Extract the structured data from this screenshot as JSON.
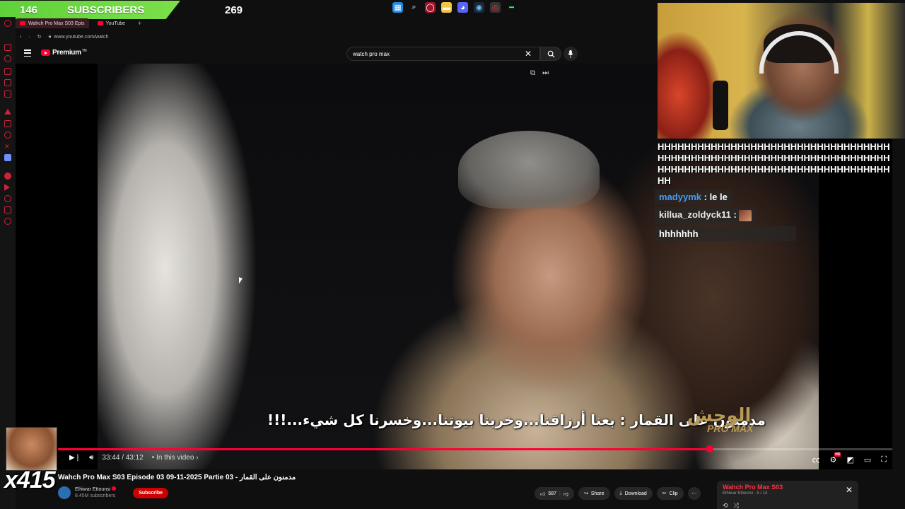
{
  "stream_overlay": {
    "subscriber_count": "146",
    "subscribers_label": "SUBSCRIBERS",
    "subscriber_goal": "269",
    "meme_counter": "x415"
  },
  "browser": {
    "tabs": [
      {
        "label": "Wahch Pro Max S03 Epis",
        "active": true
      },
      {
        "label": "YouTube",
        "active": false
      }
    ],
    "new_tab": "+",
    "url": "www.youtube.com/watch"
  },
  "youtube": {
    "logo_text": "Premium",
    "logo_tm": "TM",
    "search_query": "watch pro max"
  },
  "video": {
    "subtitle": "مدمنون على القمار : بعنا أرزاقنا...وخربنا بيوتنا...وخسرنا كل شيء...!!!",
    "watermark_ar": "الوحش",
    "watermark_en": "PRO MAX",
    "current_time": "33:44",
    "duration": "43:12",
    "time_display": "33:44 / 43:12",
    "chapter_label": "• In this video ›",
    "progress_fraction": 0.781
  },
  "video_info": {
    "title": "Wahch Pro Max S03 Episode 03 09-11-2025 Partie 03 - مدمنون على القمار",
    "channel_name": "Elhiwar Ettounsi",
    "channel_subs": "8.45M subscribers",
    "subscribe_label": "Subscribe",
    "like_count": "587",
    "share_label": "Share",
    "download_label": "Download",
    "clip_label": "Clip"
  },
  "playlist": {
    "title": "Wahch Pro Max S03",
    "subtitle": "Elhiwar Ettounsi - 5 / 14"
  },
  "chat": {
    "messages": [
      {
        "user": "",
        "text": "HHHHHHHHHHHHHHHHHHHHHHHHHHHHHHHHHHHHHHHHHHHHHHHHHHHHHHHHHHHHHHHHHHHHHHHHHHHHHHHHHHHHHHHHHHHHHHHHHHHHHHHHHHH"
      },
      {
        "user": "madyymk",
        "text": "le le"
      },
      {
        "user": "killua_zoldyck11",
        "text": ""
      },
      {
        "user": "",
        "text": "hhhhhhh"
      }
    ]
  },
  "colors": {
    "accent_red": "#ff0033",
    "sub_green": "#5fd13a",
    "chat_blue": "#4a9af0"
  }
}
